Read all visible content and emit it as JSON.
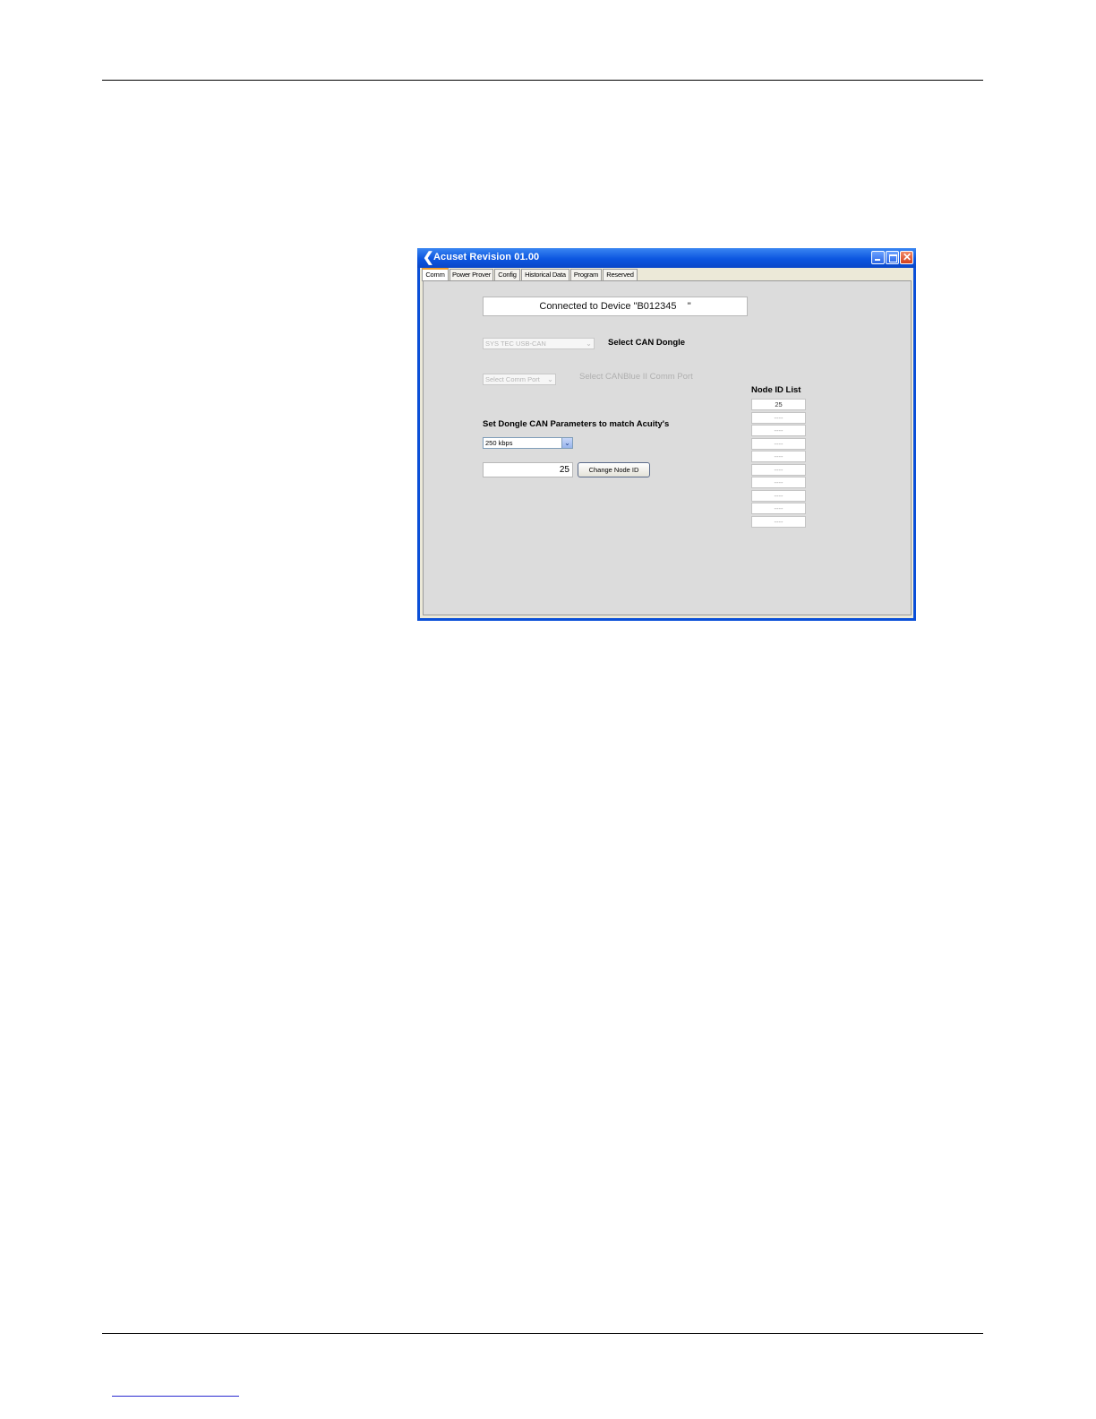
{
  "window": {
    "title": "Acuset Revision 01.00",
    "close_glyph": "✕"
  },
  "tabs": [
    {
      "label": "Comm",
      "active": true
    },
    {
      "label": "Power Prover",
      "active": false
    },
    {
      "label": "Config",
      "active": false
    },
    {
      "label": "Historical Data",
      "active": false
    },
    {
      "label": "Program",
      "active": false
    },
    {
      "label": "Reserved",
      "active": false
    }
  ],
  "comm": {
    "status_text": "Connected to Device \"B012345    \"",
    "dongle_select": {
      "value": "SYS TEC USB-CAN",
      "enabled": false
    },
    "dongle_label": "Select CAN Dongle",
    "comm_port_select": {
      "value": "Select Comm Port",
      "enabled": false
    },
    "comm_port_label": "Select CANBlue II Comm Port",
    "params_label": "Set Dongle CAN Parameters to match Acuity's",
    "baud_select": {
      "value": "250 kbps",
      "enabled": true
    },
    "node_id_value": "25",
    "change_node_button": "Change Node ID",
    "node_list_title": "Node ID List",
    "node_list": [
      "25",
      "----",
      "----",
      "----",
      "----",
      "----",
      "----",
      "----",
      "----",
      "----"
    ]
  },
  "icons": {
    "app": "acuset-app-icon",
    "dropdown": "chevron-down-icon",
    "minimize": "minimize-icon",
    "maximize": "maximize-icon",
    "close": "close-icon"
  }
}
